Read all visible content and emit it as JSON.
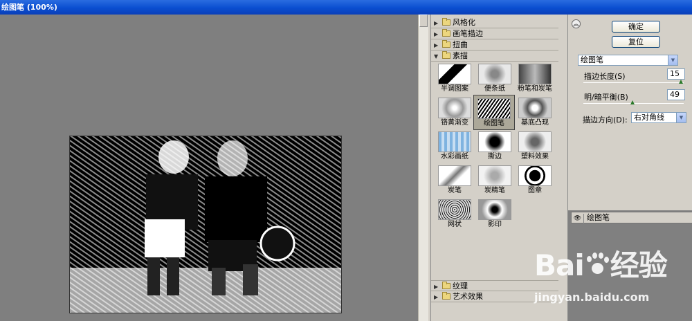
{
  "window": {
    "title": "绘图笔 (100%)"
  },
  "gallery": {
    "categories_top": [
      "风格化",
      "画笔描边",
      "扭曲",
      "素描"
    ],
    "categories_bottom": [
      "纹理",
      "艺术效果"
    ],
    "filters": [
      "半调图案",
      "便条纸",
      "粉笔和炭笔",
      "铬黄渐变",
      "绘图笔",
      "基底凸现",
      "水彩画纸",
      "撕边",
      "塑料效果",
      "炭笔",
      "炭精笔",
      "图章",
      "网状",
      "影印"
    ],
    "selected": "绘图笔"
  },
  "settings": {
    "ok_label": "确定",
    "reset_label": "复位",
    "filter_select": "绘图笔",
    "stroke_length_label": "描边长度(S)",
    "stroke_length_value": "15",
    "stroke_length_fraction": 0.97,
    "balance_label": "明/暗平衡(B)",
    "balance_value": "49",
    "balance_fraction": 0.49,
    "direction_label": "描边方向(D):",
    "direction_value": "右对角线"
  },
  "layers": {
    "active": "绘图笔"
  },
  "watermark": {
    "brand_left": "Bai",
    "brand_right": "经验",
    "url": "jingyan.baidu.com"
  },
  "colors": {
    "titlebar": "#0a4ed0",
    "preview_bg": "#7f7f7f",
    "panel": "#d4d0c8"
  }
}
